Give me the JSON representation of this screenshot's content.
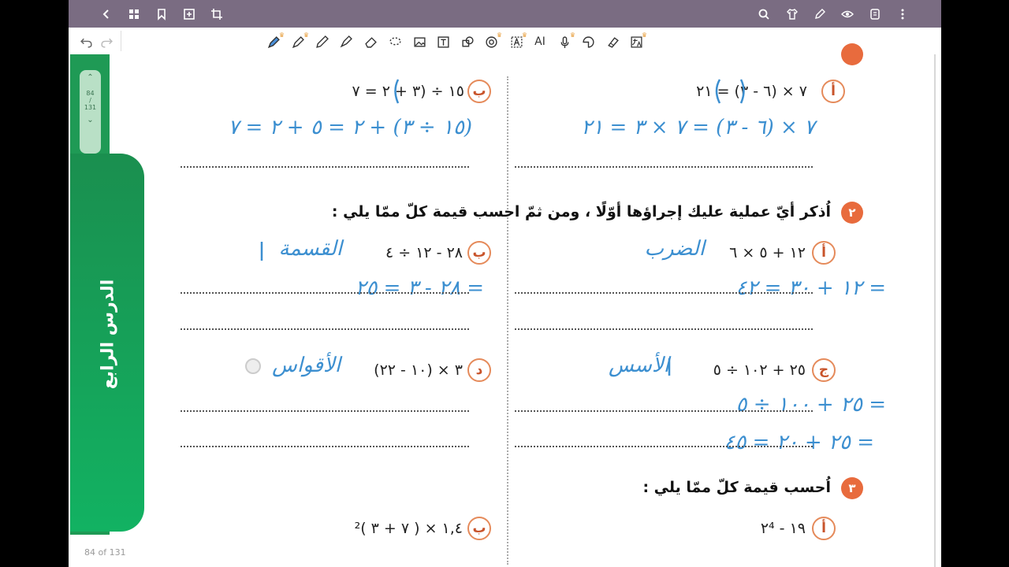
{
  "app": {
    "page_indicator": "84 of 131",
    "scroll_page": "84",
    "scroll_sep": "/",
    "scroll_total": "131",
    "lesson_tab": "الدرس الرابع"
  },
  "topbar_icons": [
    "back-icon",
    "grid-icon",
    "bookmark-icon",
    "add-page-icon",
    "crop-icon",
    "search-icon",
    "shirt-icon",
    "pen-mode-icon",
    "eye-icon",
    "document-icon",
    "more-icon"
  ],
  "tools": [
    "undo-icon",
    "redo-icon",
    "fountain-pen-icon",
    "pencil-icon",
    "pen-icon",
    "highlighter-icon",
    "eraser-icon",
    "lasso-icon",
    "image-icon",
    "text-icon",
    "shapes-icon",
    "ocr-icon",
    "text-recognition-icon",
    "ai-icon",
    "microphone-icon",
    "sticker-icon",
    "tape-icon",
    "translate-icon"
  ],
  "tool_ai_label": "AI",
  "palette": {
    "colors": [
      "#3b8ee0",
      "#2b4a8f",
      "#e01e3c",
      "#333333",
      "#111111"
    ]
  },
  "page": {
    "q1": {
      "a": {
        "label": "أ",
        "expr": "٧ × (٦ - ٣) = ٢١",
        "handwriting": "٧ × (٦ - ٣) = ٧ × ٣ = ٢١"
      },
      "b": {
        "label": "ب",
        "expr": "١٥ ÷ (٣ + ٢ = ٧",
        "handwriting": "(١٥ ÷ ٣) + ٢ = ٥ + ٢ = ٧"
      }
    },
    "q2": {
      "number": "٢",
      "prompt": "اُذكر أيّ عملية عليك إجراؤها أوّلًا ، ومن ثمّ احسب قيمة  كلّ ممّا يلي :",
      "a": {
        "label": "أ",
        "expr": "١٢ + ٥ × ٦",
        "note": "الضرب",
        "line1": "= ١٢ + ٣٠ = ٤٢"
      },
      "b": {
        "label": "ب",
        "expr": "٢٨ - ١٢ ÷ ٤",
        "note": "القسمة",
        "line1": "= ٢٨ - ٣ = ٢٥"
      },
      "c": {
        "label": "ج",
        "expr": "٢٥ + ١٠٢ ÷ ٥",
        "note": "الأسس",
        "line1": "= ٢٥ + ١٠٠ ÷ ٥",
        "line2": "= ٢٥ + ٢٠ = ٤٥"
      },
      "d": {
        "label": "د",
        "expr": "٣ × (١٠ - ٢٢)",
        "note": "الأقواس"
      }
    },
    "q3": {
      "number": "٣",
      "prompt": "اُحسب قيمة كلّ ممّا يلي :",
      "a": {
        "label": "أ",
        "expr": "١٩ - ٢⁴"
      },
      "b": {
        "label": "ب",
        "expr": "١,٤ × ( ٧ + ٣ )²"
      }
    }
  }
}
